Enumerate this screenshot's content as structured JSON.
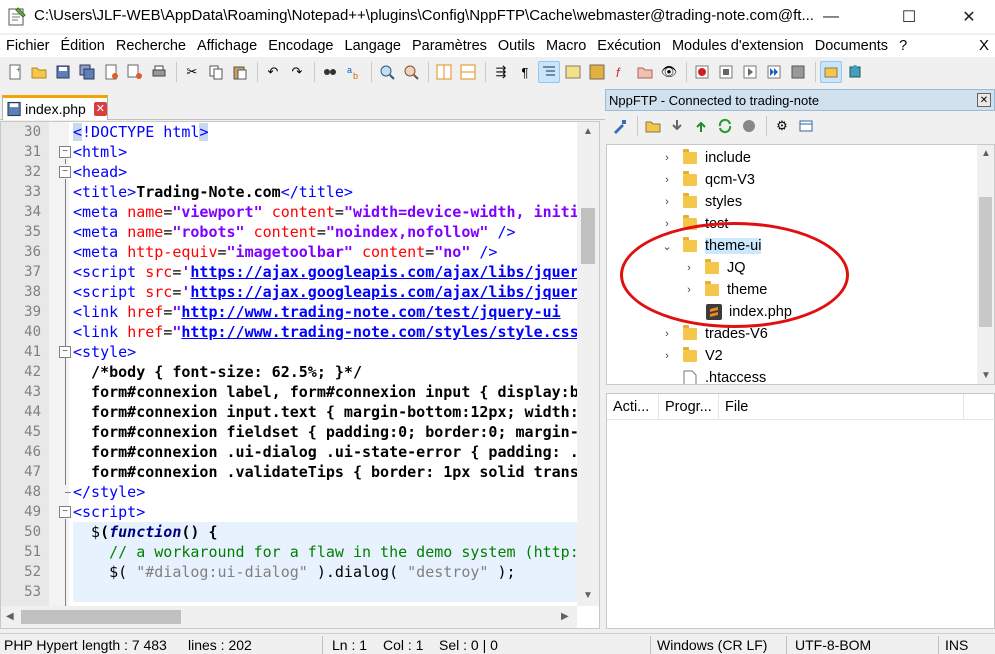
{
  "window": {
    "title": "C:\\Users\\JLF-WEB\\AppData\\Roaming\\Notepad++\\plugins\\Config\\NppFTP\\Cache\\webmaster@trading-note.com@ft...",
    "min": "—",
    "max": "☐",
    "close": "✕"
  },
  "menu": [
    "Fichier",
    "Édition",
    "Recherche",
    "Affichage",
    "Encodage",
    "Langage",
    "Paramètres",
    "Outils",
    "Macro",
    "Exécution",
    "Modules d'extension",
    "Documents",
    "?"
  ],
  "menu_close": "X",
  "tab": {
    "label": "index.php",
    "close": "✕"
  },
  "editor": {
    "line_numbers": [
      "30",
      "31",
      "32",
      "33",
      "34",
      "35",
      "36",
      "37",
      "38",
      "39",
      "40",
      "41",
      "42",
      "43",
      "44",
      "45",
      "46",
      "47",
      "48",
      "49",
      "50",
      "51",
      "52",
      "53"
    ]
  },
  "ftp": {
    "title": "NppFTP - Connected to trading-note",
    "close": "✕",
    "tree": [
      {
        "label": "include",
        "type": "folder"
      },
      {
        "label": "qcm-V3",
        "type": "folder"
      },
      {
        "label": "styles",
        "type": "folder"
      },
      {
        "label": "test",
        "type": "folder"
      },
      {
        "label": "theme-ui",
        "type": "folder",
        "expanded": true
      },
      {
        "label": "JQ",
        "type": "folder"
      },
      {
        "label": "theme",
        "type": "folder"
      },
      {
        "label": "index.php",
        "type": "file"
      },
      {
        "label": "trades-V6",
        "type": "folder"
      },
      {
        "label": "V2",
        "type": "folder"
      },
      {
        "label": ".htaccess",
        "type": "file"
      }
    ],
    "queue_cols": [
      "Acti...",
      "Progr...",
      "File"
    ]
  },
  "status": {
    "lang": "PHP Hypert",
    "length": "length : 7 483",
    "lines": "lines : 202",
    "ln": "Ln : 1",
    "col": "Col : 1",
    "sel": "Sel : 0 | 0",
    "eol": "Windows (CR LF)",
    "enc": "UTF-8-BOM",
    "ins": "INS"
  },
  "colors": {
    "accent": "#f2a500",
    "highlight_ellipse": "#e01010",
    "selected": "#cce8ff"
  }
}
